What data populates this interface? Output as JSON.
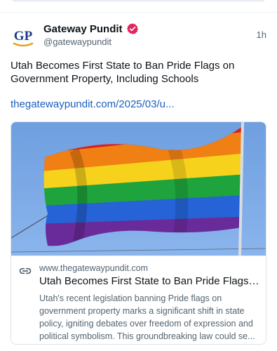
{
  "post": {
    "author": {
      "display_name": "Gateway Pundit",
      "handle": "@gatewaypundit",
      "avatar_text": "GP",
      "verified_icon": "verified-badge-icon"
    },
    "timestamp": "1h",
    "text": "Utah Becomes First State to Ban Pride Flags on Government Property, Including Schools",
    "link_text": "thegatewaypundit.com/2025/03/u...",
    "embed": {
      "image_icon": "rainbow-pride-flag-photo",
      "link_icon": "link-icon",
      "domain": "www.thegatewaypundit.com",
      "title": "Utah Becomes First State to Ban Pride Flags o...",
      "description_lines": [
        "Utah's recent legislation banning Pride flags on",
        "government property marks a significant shift in state",
        "policy, igniting debates over freedom of expression and",
        "political symbolism. This groundbreaking law could se..."
      ]
    }
  },
  "colors": {
    "link": "#1d5fbf",
    "verified_badge": "#e0245e",
    "secondary_text": "#536471"
  }
}
